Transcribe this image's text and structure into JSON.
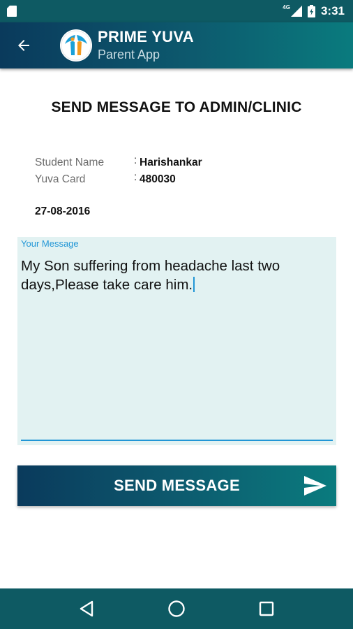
{
  "status_bar": {
    "network_label": "4G",
    "time": "3:31"
  },
  "app_bar": {
    "title": "PRIME YUVA",
    "subtitle": "Parent App"
  },
  "page": {
    "heading": "SEND MESSAGE TO ADMIN/CLINIC"
  },
  "student": {
    "name_label": "Student Name",
    "name_value": "Harishankar",
    "card_label": "Yuva Card",
    "card_value": "480030",
    "colon": ":"
  },
  "date": "27-08-2016",
  "message": {
    "label": "Your Message",
    "value": "My Son suffering from headache last two days,Please take care him."
  },
  "send_button": {
    "label": "SEND MESSAGE"
  },
  "icons": {
    "status": [
      "sd-card-icon",
      "signal-icon",
      "battery-icon"
    ],
    "app_bar": [
      "back-arrow-icon",
      "prime-yuva-logo"
    ],
    "actions": [
      "send-icon"
    ],
    "navigation": [
      "back-triangle-icon",
      "home-circle-icon",
      "recents-square-icon"
    ]
  },
  "colors": {
    "primary_dark": "#0a3a5c",
    "primary_teal": "#0a7b7e",
    "accent_blue": "#2196d6",
    "message_bg": "#e2f2f2"
  }
}
